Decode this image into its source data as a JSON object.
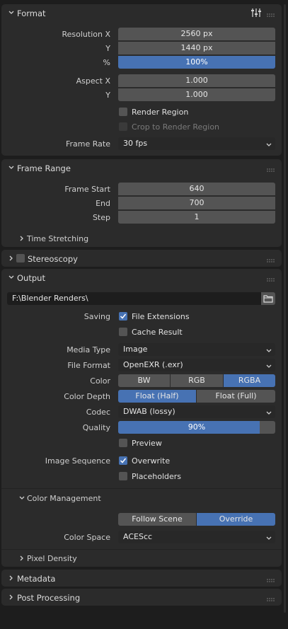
{
  "colors": {
    "accent": "#4772b3",
    "panel": "#2b2b2b",
    "field": "#545454",
    "dropdown": "#282828"
  },
  "format": {
    "title": "Format",
    "resolution_x_label": "Resolution X",
    "resolution_x": "2560 px",
    "resolution_y_label": "Y",
    "resolution_y": "1440 px",
    "percent_label": "%",
    "percent": "100%",
    "aspect_x_label": "Aspect X",
    "aspect_x": "1.000",
    "aspect_y_label": "Y",
    "aspect_y": "1.000",
    "render_region": "Render Region",
    "crop_region": "Crop to Render Region",
    "frame_rate_label": "Frame Rate",
    "frame_rate": "30 fps"
  },
  "frame_range": {
    "title": "Frame Range",
    "start_label": "Frame Start",
    "start": "640",
    "end_label": "End",
    "end": "700",
    "step_label": "Step",
    "step": "1",
    "time_stretching": "Time Stretching"
  },
  "stereoscopy": {
    "title": "Stereoscopy"
  },
  "output": {
    "title": "Output",
    "path": "F:\\Blender Renders\\",
    "saving_label": "Saving",
    "file_extensions": "File Extensions",
    "cache_result": "Cache Result",
    "media_type_label": "Media Type",
    "media_type": "Image",
    "file_format_label": "File Format",
    "file_format": "OpenEXR (.exr)",
    "color_label": "Color",
    "color_options": [
      "BW",
      "RGB",
      "RGBA"
    ],
    "color_selected": "RGBA",
    "color_depth_label": "Color Depth",
    "color_depth_options": [
      "Float (Half)",
      "Float (Full)"
    ],
    "color_depth_selected": "Float (Half)",
    "codec_label": "Codec",
    "codec": "DWAB (lossy)",
    "quality_label": "Quality",
    "quality": "90%",
    "quality_fraction": 0.9,
    "preview": "Preview",
    "image_sequence_label": "Image Sequence",
    "overwrite": "Overwrite",
    "placeholders": "Placeholders",
    "color_management": "Color Management",
    "cm_options": [
      "Follow Scene",
      "Override"
    ],
    "cm_selected": "Override",
    "color_space_label": "Color Space",
    "color_space": "ACEScc",
    "pixel_density": "Pixel Density"
  },
  "metadata": {
    "title": "Metadata"
  },
  "post_processing": {
    "title": "Post Processing"
  }
}
